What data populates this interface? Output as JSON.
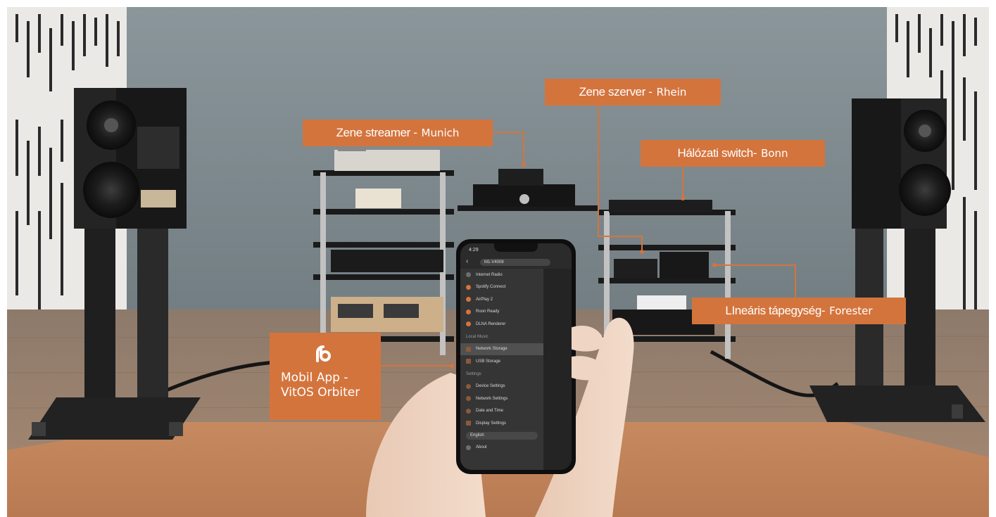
{
  "callouts": {
    "streamer": {
      "lead": "Zene streamer -",
      "name": "Munich"
    },
    "server": {
      "lead": "Zene szerver -",
      "name": "Rhein"
    },
    "switch": {
      "lead": "Hálózati switch-",
      "name": "Bonn"
    },
    "psu": {
      "lead": "LIneáris tápegység-",
      "name": "Forester"
    },
    "app": {
      "line1": "Mobil App -",
      "line2": "VitOS Orbiter"
    }
  },
  "phone": {
    "status_time": "4:29",
    "device_name": "M1-V4008",
    "menu_items": [
      {
        "label": "Internet Radio",
        "icon": "radio-icon"
      },
      {
        "label": "Spotify Connect",
        "icon": "spotify-icon"
      },
      {
        "label": "AirPlay 2",
        "icon": "airplay-icon"
      },
      {
        "label": "Roon Ready",
        "icon": "roon-icon"
      },
      {
        "label": "DLNA Renderer",
        "icon": "dlna-icon"
      }
    ],
    "local_music_header": "Local Music",
    "local_items": [
      {
        "label": "Network Storage",
        "icon": "network-storage-icon"
      },
      {
        "label": "USB Storage",
        "icon": "usb-icon"
      }
    ],
    "settings_header": "Settings",
    "settings_items": [
      {
        "label": "Device Settings",
        "icon": "device-settings-icon"
      },
      {
        "label": "Network Settings",
        "icon": "network-settings-icon"
      },
      {
        "label": "Date and Time",
        "icon": "clock-icon"
      },
      {
        "label": "Display Settings",
        "icon": "display-icon"
      }
    ],
    "language": "English",
    "about": "About"
  },
  "colors": {
    "callout": "#d4743d",
    "leader_line": "#d4743d",
    "wall": "#7f8b91",
    "carpet": "#c98d64"
  }
}
